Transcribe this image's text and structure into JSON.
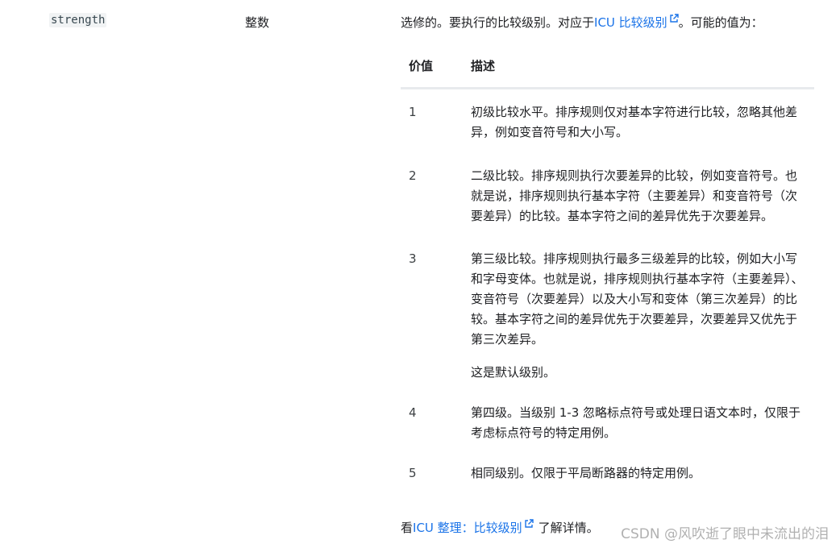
{
  "field": {
    "name": "strength",
    "type": "整数"
  },
  "description": {
    "intro_before": "选修的。要执行的比较级别。对应于",
    "intro_link": "ICU 比较级别",
    "intro_after": "。可能的值为："
  },
  "table": {
    "headers": [
      "价值",
      "描述"
    ],
    "rows": [
      {
        "value": "1",
        "paragraphs": [
          "初级比较水平。排序规则仅对基本字符进行比较，忽略其他差异，例如变音符号和大小写。"
        ]
      },
      {
        "value": "2",
        "paragraphs": [
          "二级比较。排序规则执行次要差异的比较，例如变音符号。也就是说，排序规则执行基本字符（主要差异）和变音符号（次要差异）的比较。基本字符之间的差异优先于次要差异。"
        ]
      },
      {
        "value": "3",
        "paragraphs": [
          "第三级比较。排序规则执行最多三级差异的比较，例如大小写和字母变体。也就是说，排序规则执行基本字符（主要差异）、变音符号（次要差异）以及大小写和变体（第三次差异）的比较。基本字符之间的差异优先于次要差异，次要差异又优先于第三次差异。",
          "这是默认级别。"
        ]
      },
      {
        "value": "4",
        "paragraphs": [
          "第四级。当级别 1-3 忽略标点符号或处理日语文本时，仅限于考虑标点符号的特定用例。"
        ]
      },
      {
        "value": "5",
        "paragraphs": [
          "相同级别。仅限于平局断路器的特定用例。"
        ]
      }
    ]
  },
  "footer": {
    "before": "看",
    "link": "ICU 整理：比较级别",
    "after": "了解详情。"
  },
  "watermark": "CSDN @风吹逝了眼中未流出的泪",
  "colors": {
    "link": "#1a73e8",
    "code_bg": "#f1f3f4",
    "header_rule": "#e8eaed"
  },
  "icons": {
    "external_link": "external-link-icon"
  }
}
